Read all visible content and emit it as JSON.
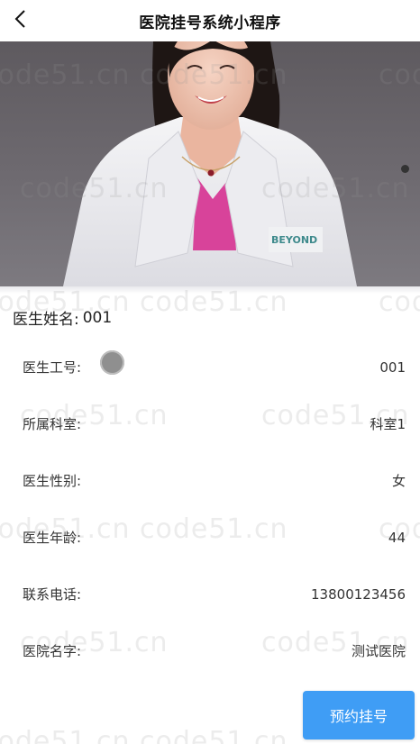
{
  "nav": {
    "title": "医院挂号系统小程序",
    "back_icon": "chevron-left-icon"
  },
  "banner": {
    "image": "doctor-portrait",
    "coat_text": "BEYOND",
    "active_dot_color": "#333333"
  },
  "doctor": {
    "name_label": "医生姓名:",
    "name_value": "001",
    "fields": [
      {
        "label": "医生工号:",
        "value": "001"
      },
      {
        "label": "所属科室:",
        "value": "科室1"
      },
      {
        "label": "医生性别:",
        "value": "女"
      },
      {
        "label": "医生年龄:",
        "value": "44"
      },
      {
        "label": "联系电话:",
        "value": "13800123456"
      },
      {
        "label": "医院名字:",
        "value": "测试医院"
      }
    ]
  },
  "actions": {
    "book_label": "预约挂号",
    "book_color": "#3f9df5"
  },
  "watermark": {
    "text": "code51.cn"
  }
}
